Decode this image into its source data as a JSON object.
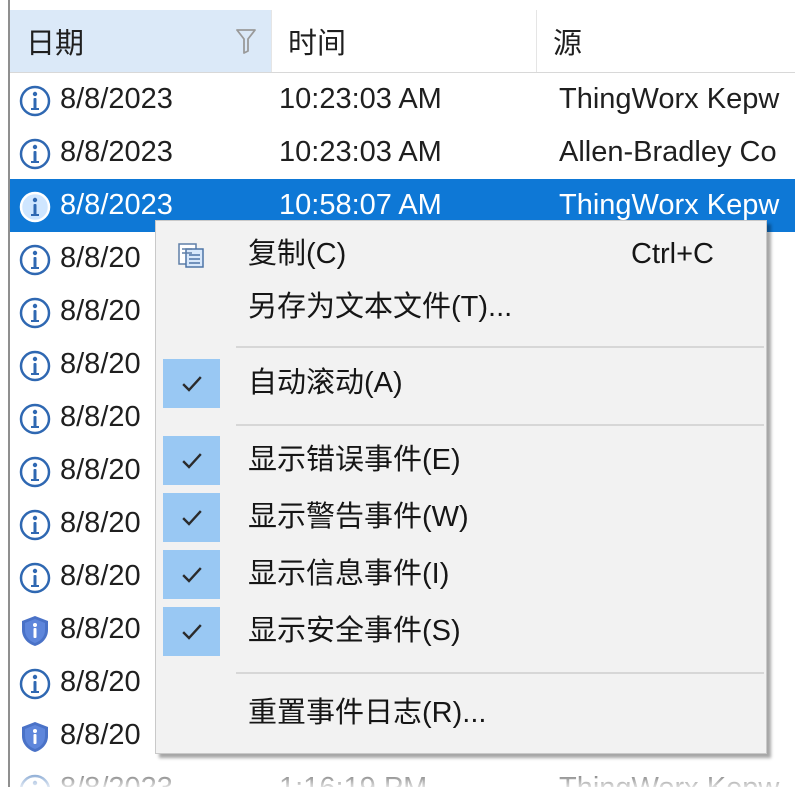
{
  "table": {
    "headers": {
      "date": "日期",
      "time": "时间",
      "source": "源"
    },
    "rows": [
      {
        "icon": "info-icon",
        "date": "8/8/2023",
        "time": "10:23:03 AM",
        "source": "ThingWorx Kepw"
      },
      {
        "icon": "info-icon",
        "date": "8/8/2023",
        "time": "10:23:03 AM",
        "source": "Allen-Bradley Co"
      },
      {
        "icon": "info-icon",
        "date": "8/8/2023",
        "time": "10:58:07 AM",
        "source": "ThingWorx Kepw",
        "selected": true
      },
      {
        "icon": "info-icon",
        "date": "8/8/20",
        "time": "",
        "source": "w"
      },
      {
        "icon": "info-icon",
        "date": "8/8/20",
        "time": "",
        "source": "w"
      },
      {
        "icon": "info-icon",
        "date": "8/8/20",
        "time": "",
        "source": "w"
      },
      {
        "icon": "info-icon",
        "date": "8/8/20",
        "time": "",
        "source": "w"
      },
      {
        "icon": "info-icon",
        "date": "8/8/20",
        "time": "",
        "source": "w"
      },
      {
        "icon": "info-icon",
        "date": "8/8/20",
        "time": "",
        "source": "w"
      },
      {
        "icon": "info-icon",
        "date": "8/8/20",
        "time": "",
        "source": ""
      },
      {
        "icon": "security-shield-icon",
        "date": "8/8/20",
        "time": "",
        "source": "w"
      },
      {
        "icon": "info-icon",
        "date": "8/8/20",
        "time": "",
        "source": "w"
      },
      {
        "icon": "security-shield-icon",
        "date": "8/8/20",
        "time": "",
        "source": "w"
      },
      {
        "icon": "info-icon",
        "date": "8/8/2023",
        "time": "1:16:19 PM",
        "source": "ThingWorx Kepw"
      }
    ]
  },
  "context_menu": {
    "items": [
      {
        "id": "copy",
        "icon": "copy-icon",
        "label": "复制(C)",
        "shortcut": "Ctrl+C",
        "checked": false
      },
      {
        "id": "save-as-text",
        "icon": "",
        "label": "另存为文本文件(T)...",
        "shortcut": "",
        "checked": false
      },
      {
        "id": "auto-scroll",
        "icon": "checkmark-icon",
        "label": "自动滚动(A)",
        "shortcut": "",
        "checked": true
      },
      {
        "id": "show-errors",
        "icon": "checkmark-icon",
        "label": "显示错误事件(E)",
        "shortcut": "",
        "checked": true
      },
      {
        "id": "show-warnings",
        "icon": "checkmark-icon",
        "label": "显示警告事件(W)",
        "shortcut": "",
        "checked": true
      },
      {
        "id": "show-info",
        "icon": "checkmark-icon",
        "label": "显示信息事件(I)",
        "shortcut": "",
        "checked": true
      },
      {
        "id": "show-security",
        "icon": "checkmark-icon",
        "label": "显示安全事件(S)",
        "shortcut": "",
        "checked": true
      },
      {
        "id": "reset-log",
        "icon": "",
        "label": "重置事件日志(R)...",
        "shortcut": "",
        "checked": false
      }
    ]
  },
  "colors": {
    "selection": "#0e78d6",
    "header_active": "#dbe9f8",
    "menu_background": "#f2f2f2",
    "check_background": "#99c8f3",
    "info_icon": "#2f68b2",
    "security_icon": "#4a72c7"
  }
}
